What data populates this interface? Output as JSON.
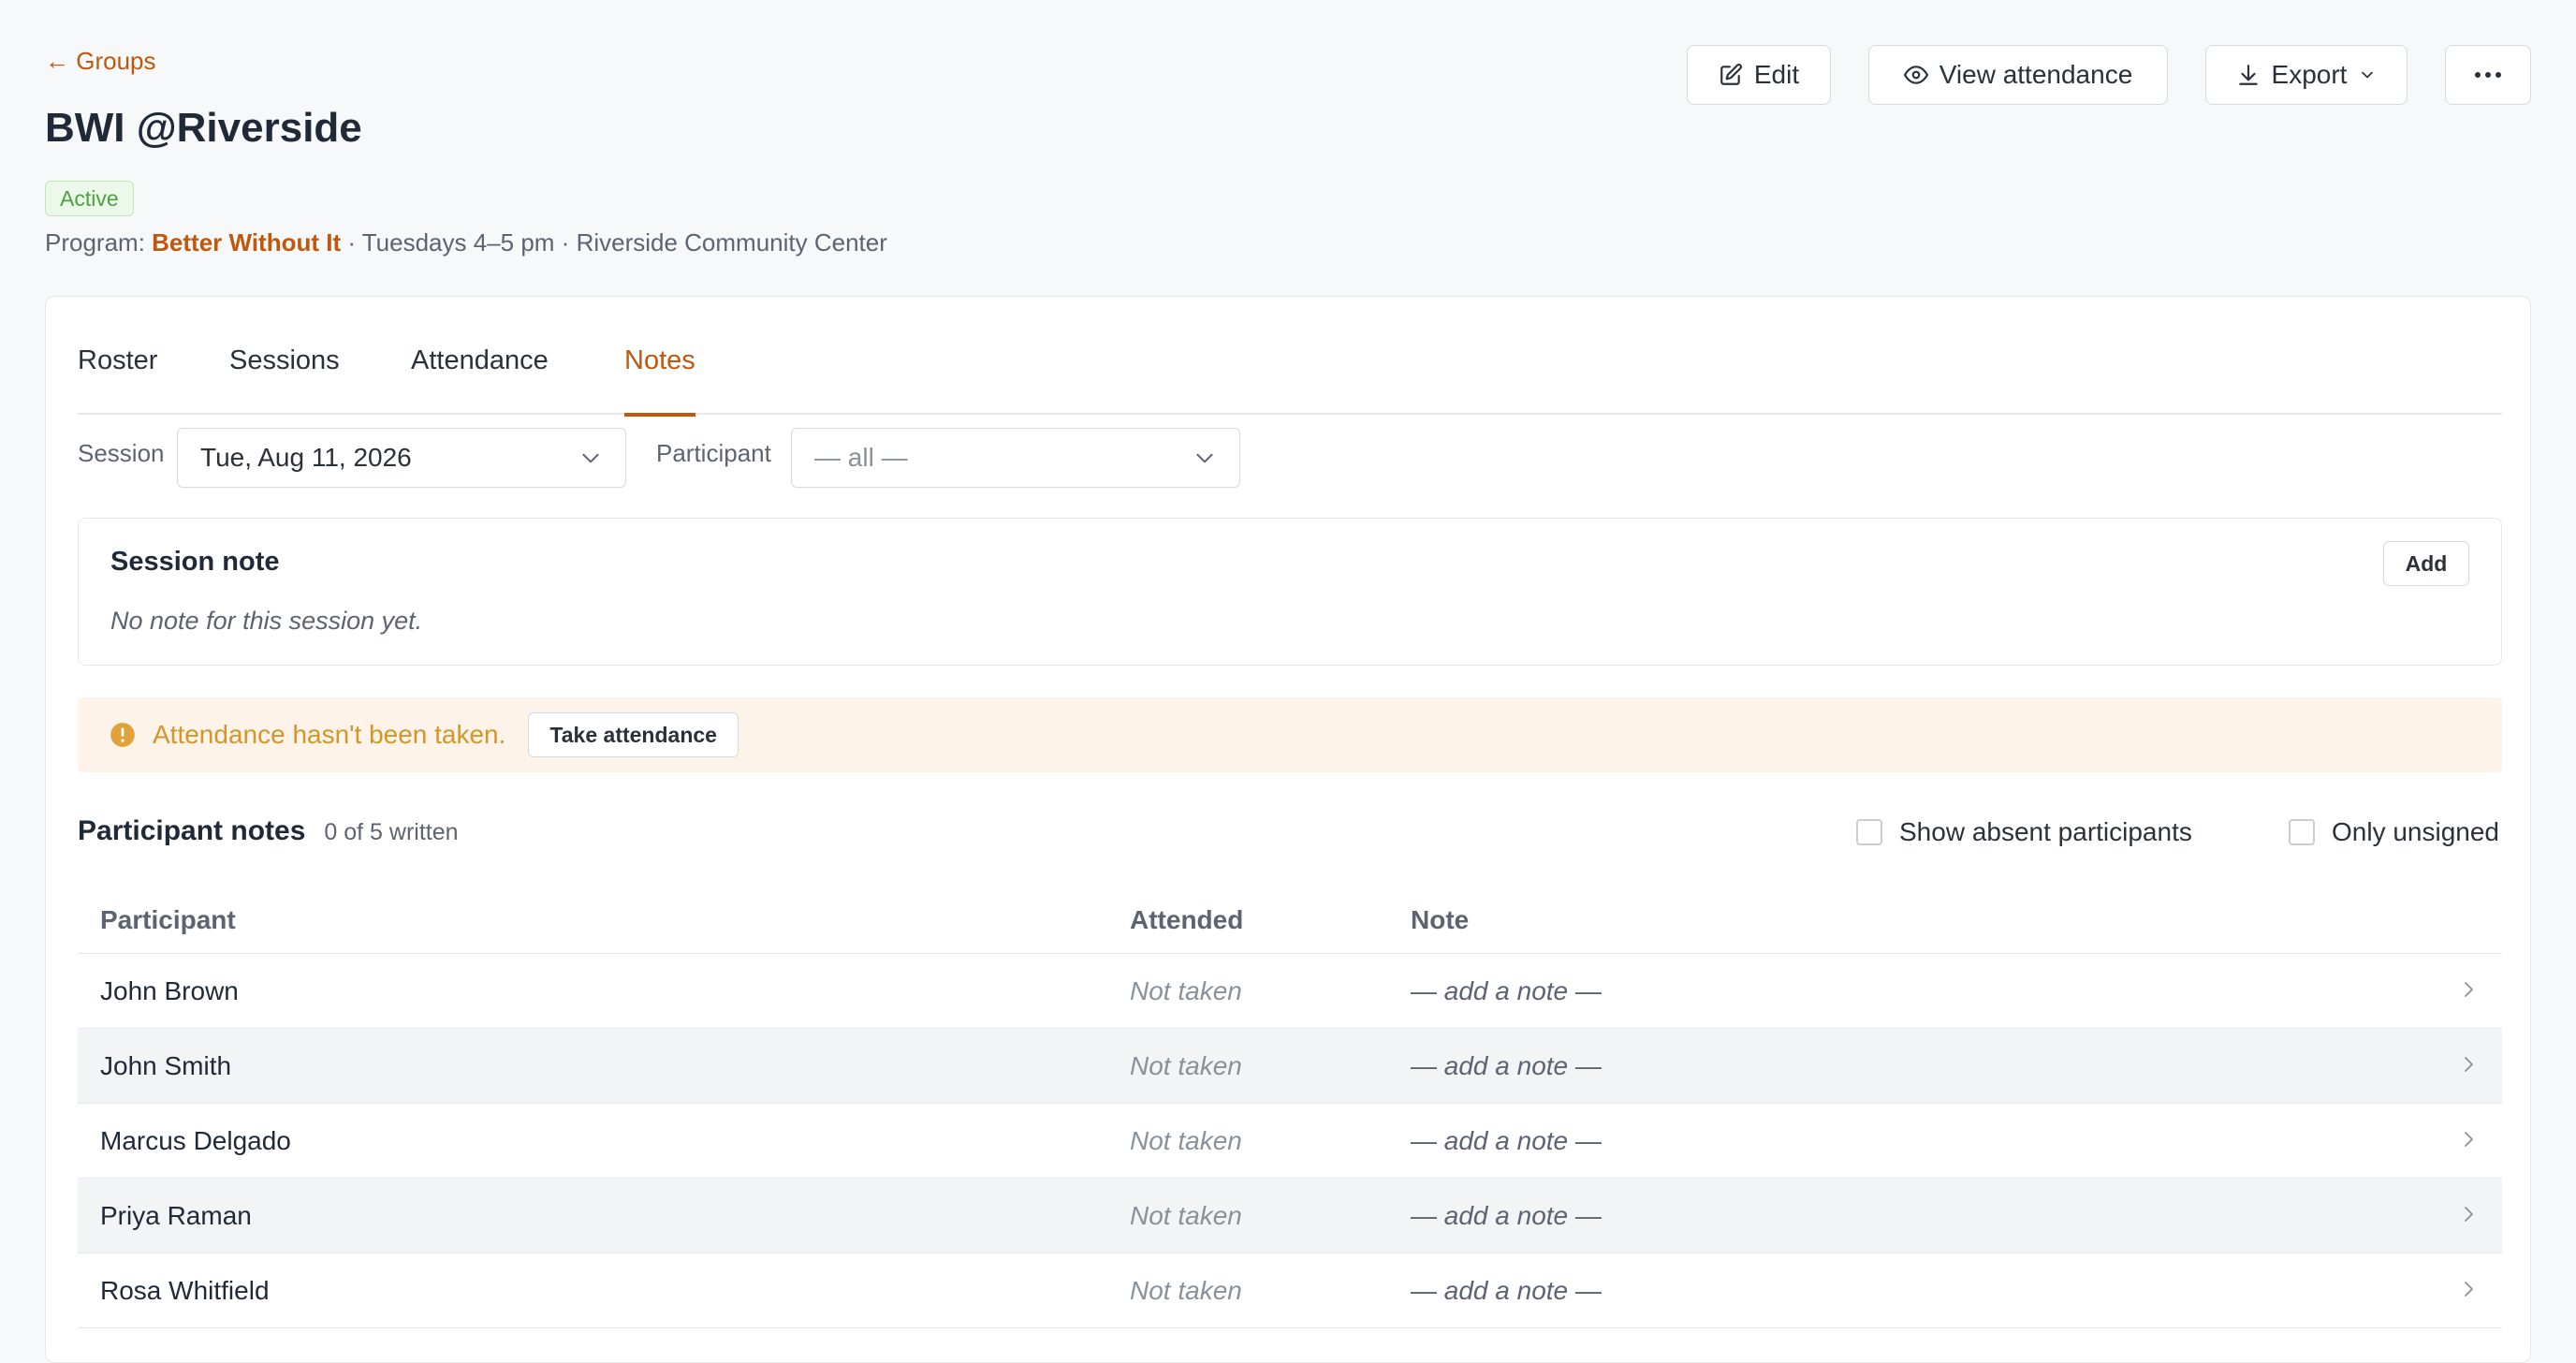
{
  "header": {
    "back_label": "← Groups",
    "title": "BWI @Riverside",
    "status": "Active",
    "meta_prefix": "Program: ",
    "program": "Better Without It",
    "meta_suffix": " · Tuesdays 4–5 pm · Riverside Community Center",
    "actions": {
      "edit": "Edit",
      "view_attendance": "View attendance",
      "export": "Export"
    }
  },
  "tabs": [
    {
      "label": "Roster"
    },
    {
      "label": "Sessions"
    },
    {
      "label": "Attendance"
    },
    {
      "label": "Notes"
    }
  ],
  "active_tab": "Notes",
  "filters": {
    "session_label": "Session",
    "session_value": "Tue, Aug 11, 2026",
    "participant_label": "Participant",
    "participant_value": "— all —"
  },
  "session_note": {
    "title": "Session note",
    "empty_text": "No note for this session yet.",
    "add_label": "Add"
  },
  "alert": {
    "text": "Attendance hasn't been taken.",
    "button": "Take attendance"
  },
  "participant_notes": {
    "title": "Participant notes",
    "count": "0 of 5 written",
    "show_absent_label": "Show absent participants",
    "only_unsigned_label": "Only unsigned",
    "columns": [
      "Participant",
      "Attended",
      "Note"
    ],
    "rows": [
      {
        "name": "John Brown",
        "attended": "Not taken",
        "note": "— add a note —"
      },
      {
        "name": "John Smith",
        "attended": "Not taken",
        "note": "— add a note —"
      },
      {
        "name": "Marcus Delgado",
        "attended": "Not taken",
        "note": "— add a note —"
      },
      {
        "name": "Priya Raman",
        "attended": "Not taken",
        "note": "— add a note —"
      },
      {
        "name": "Rosa Whitfield",
        "attended": "Not taken",
        "note": "— add a note —"
      }
    ]
  },
  "colors": {
    "accent": "#c2570c",
    "active_badge": "#4ea043",
    "warning": "#d4952a",
    "warning_bg": "#fdf3e8"
  }
}
